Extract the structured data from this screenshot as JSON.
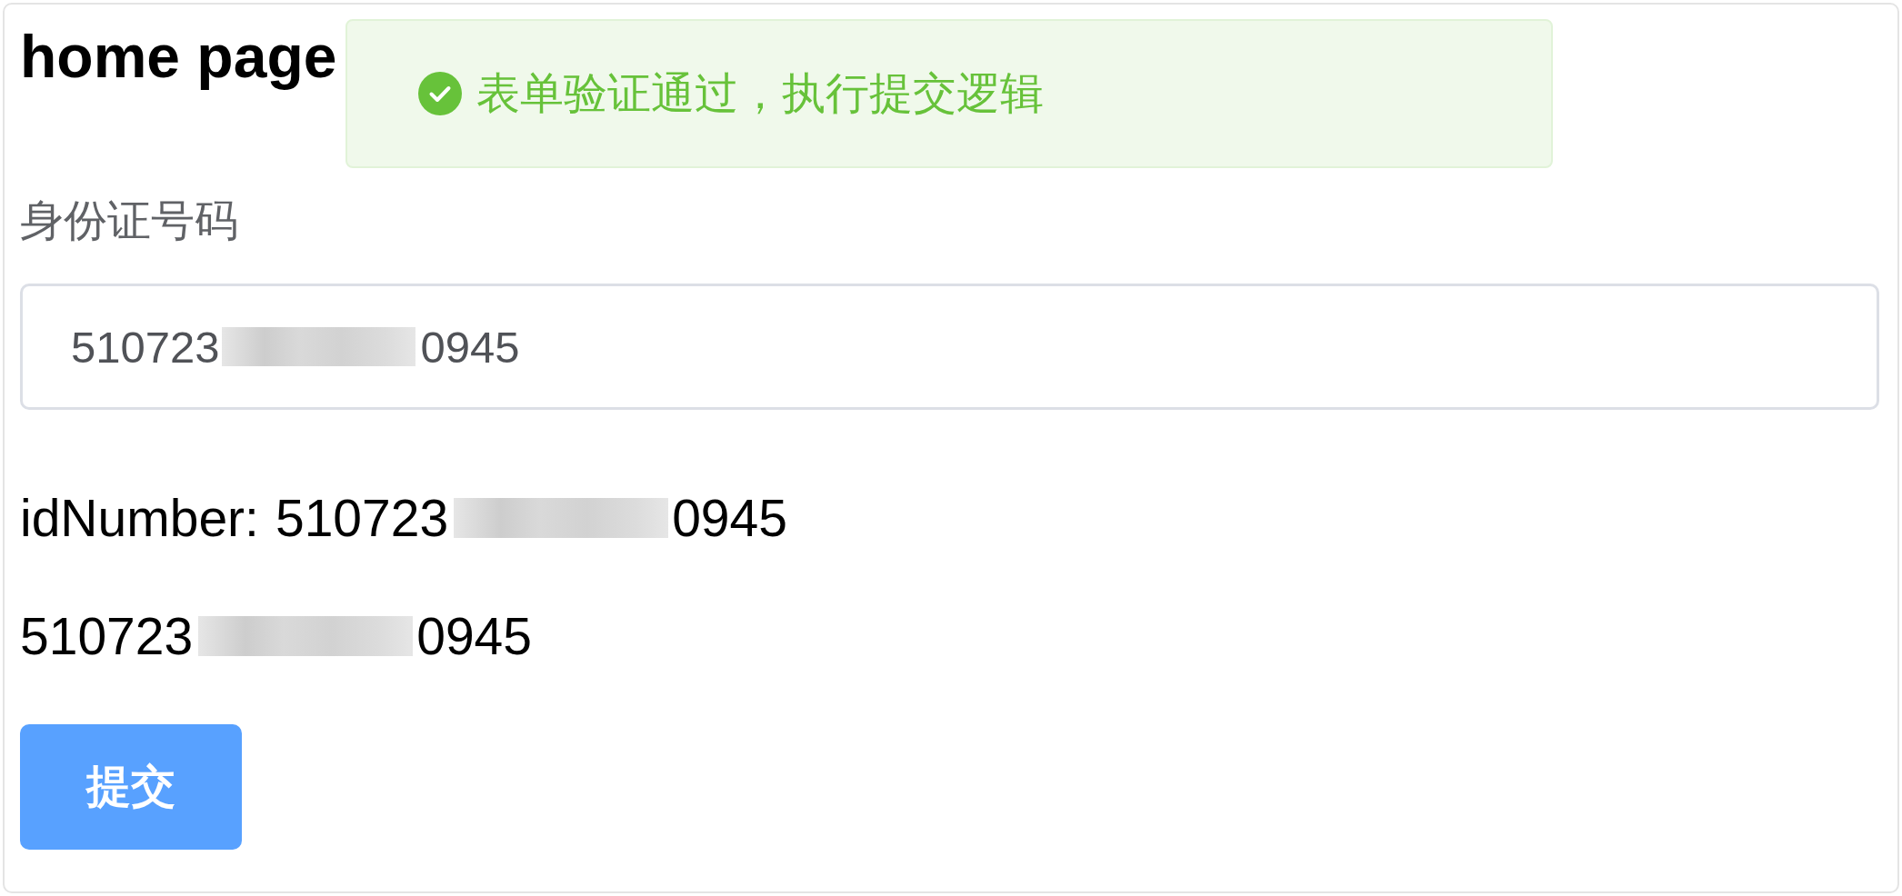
{
  "page": {
    "title": "home page"
  },
  "toast": {
    "kind": "success",
    "message": "表单验证通过，执行提交逻辑"
  },
  "form": {
    "label": "身份证号码",
    "field": {
      "value_start": "510723",
      "value_end": "0945",
      "redacted": true
    }
  },
  "outputs": [
    {
      "label": "idNumber:",
      "value_start": "510723",
      "value_end": "0945",
      "redacted": true
    },
    {
      "value_start": "510723",
      "value_end": "0945",
      "redacted": true
    }
  ],
  "buttons": [
    {
      "label": "提交",
      "kind": "primary"
    }
  ]
}
